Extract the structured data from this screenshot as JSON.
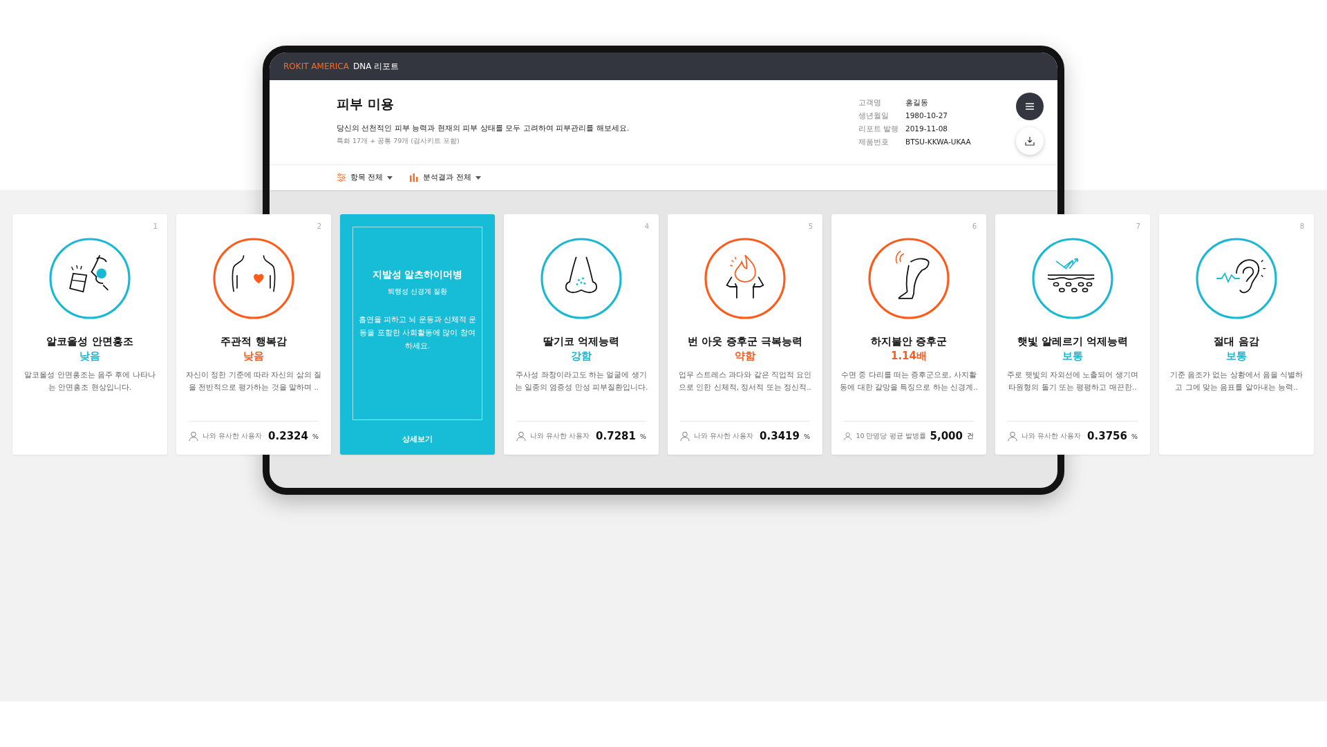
{
  "brand": {
    "company": "ROKIT AMERICA",
    "product": "DNA 리포트"
  },
  "header": {
    "title": "피부 미용",
    "description": "당신의 선천적인 피부 능력과 현재의 피부 상태를 모두 고려하여 피부관리를 해보세요.",
    "summary": "특화 17개 + 공통 79개 (검사키트 포함)",
    "info": [
      {
        "label": "고객명",
        "value": "홍길동"
      },
      {
        "label": "생년월일",
        "value": "1980-10-27"
      },
      {
        "label": "리포트 발행",
        "value": "2019-11-08"
      },
      {
        "label": "제품번호",
        "value": "BTSU-KKWA-UKAA"
      }
    ]
  },
  "filters": [
    {
      "kind": "items",
      "label": "항목 전체"
    },
    {
      "kind": "results",
      "label": "분석결과 전체"
    }
  ],
  "cards": [
    {
      "kind": "trait",
      "number": "1",
      "title": "알코올성 안면홍조",
      "result": "낮음",
      "color": "#17b8d4",
      "description": "알코올성 안면홍조는 음주 후에 나타나는 안면홍조 현상입니다."
    },
    {
      "kind": "trait",
      "number": "2",
      "title": "주관적 행복감",
      "result": "낮음",
      "color": "#ff5a1a",
      "description": "자신이 정한 기준에 따라 자신의 삶의 질을 전반적으로 평가하는 것을 말하며 ..",
      "footer": {
        "label": "나와 유사한 사용자",
        "value": "0.2324",
        "unit": "%"
      }
    },
    {
      "kind": "highlight",
      "title": "지발성 알츠하이머병",
      "subtitle": "퇴행성 신경계 질환",
      "body": "흡연을 피하고 뇌 운동과 신체적 운동을 포함한 사회활동에 많이 참여하세요.",
      "link": "상세보기"
    },
    {
      "kind": "trait",
      "number": "4",
      "title": "딸기코 억제능력",
      "result": "강함",
      "color": "#17b8d4",
      "description": "주사성 좌창이라고도 하는 얼굴에 생기는 일종의 염증성 만성 피부질환입니다.",
      "footer": {
        "label": "나와 유사한 사용자",
        "value": "0.7281",
        "unit": "%"
      }
    },
    {
      "kind": "trait",
      "number": "5",
      "title": "번 아웃 증후군 극복능력",
      "result": "약함",
      "color": "#ff5a1a",
      "description": "업무 스트레스 과다와 같은 직업적 요인으로 인한 신체적, 정서적 또는 정신적..",
      "footer": {
        "label": "나와 유사한 사용자",
        "value": "0.3419",
        "unit": "%"
      }
    },
    {
      "kind": "trait",
      "number": "6",
      "title": "하지불안 증후군",
      "result": "1.14배",
      "color": "#ff5a1a",
      "description": "수면 중 다리를 떠는 증후군으로, 사지활동에 대한 갈망을 특징으로 하는 신경계..",
      "footer": {
        "label": "10 만명당 평균 발병률",
        "value": "5,000",
        "unit": "건"
      }
    },
    {
      "kind": "trait",
      "number": "7",
      "title": "햇빛 알레르기 억제능력",
      "result": "보통",
      "color": "#17b8d4",
      "description": "주로 햇빛의 자외선에 노출되어 생기며 타원형의 돌기 또는 평평하고 매끈한..",
      "footer": {
        "label": "나와 유사한 사용자",
        "value": "0.3756",
        "unit": "%"
      }
    },
    {
      "kind": "trait",
      "number": "8",
      "title": "절대 음감",
      "result": "보통",
      "color": "#17b8d4",
      "description": "기준 음조가 없는 상황에서 음을 식별하고 그에 맞는 음표를 알아내는 능력.."
    }
  ]
}
